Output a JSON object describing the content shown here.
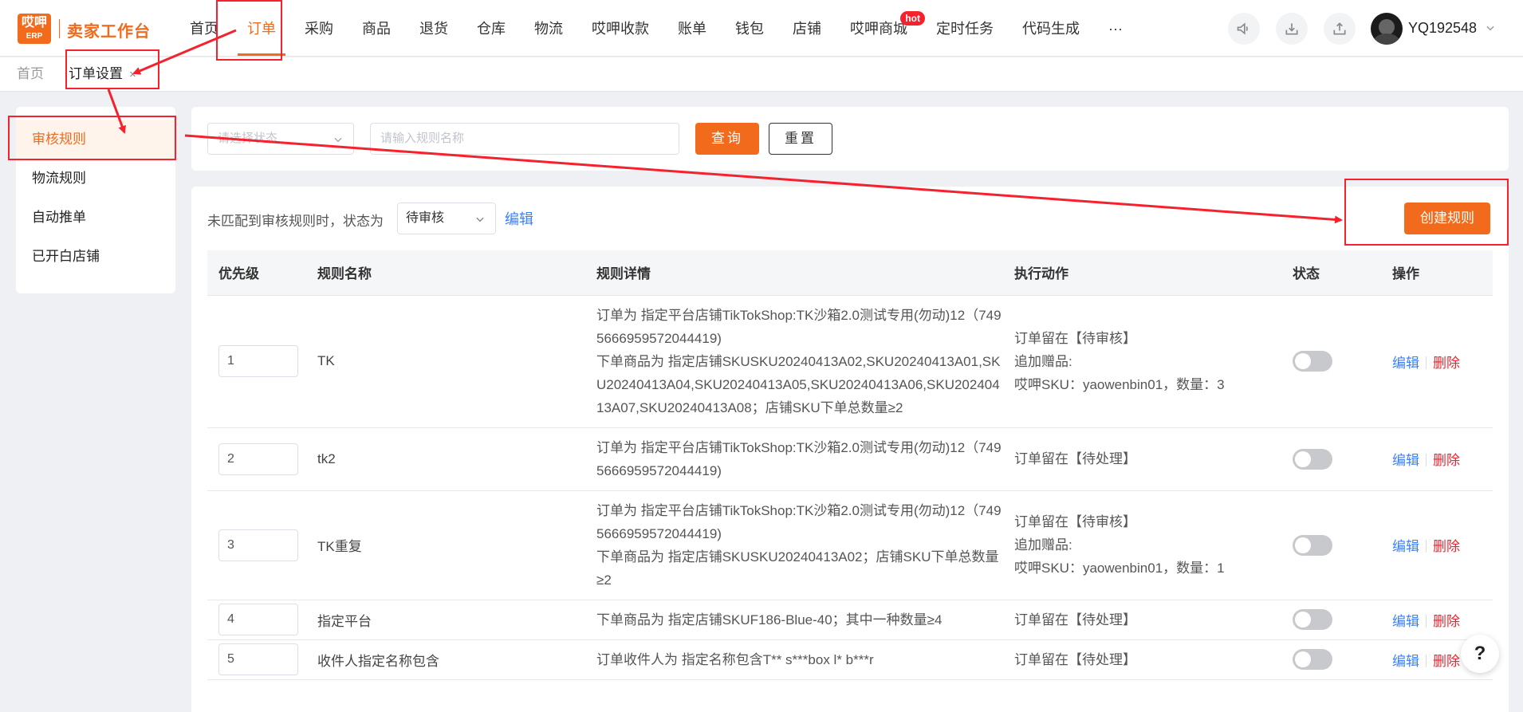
{
  "app": {
    "logo_top": "哎呷",
    "logo_bottom": "ERP",
    "title": "卖家工作台"
  },
  "nav": {
    "items": [
      "首页",
      "订单",
      "采购",
      "商品",
      "退货",
      "仓库",
      "物流",
      "哎呷收款",
      "账单",
      "钱包",
      "店铺",
      "哎呷商城",
      "定时任务",
      "代码生成",
      "···"
    ],
    "active_index": 1,
    "hot_badge": "hot"
  },
  "header_icons": [
    "megaphone-icon",
    "download-icon",
    "upload-icon"
  ],
  "user": {
    "name": "YQ192548"
  },
  "breadcrumb_tabs": {
    "home": "首页",
    "current": "订单设置",
    "close": "×"
  },
  "sidebar": {
    "items": [
      "审核规则",
      "物流规则",
      "自动推单",
      "已开白店铺"
    ],
    "active_index": 0
  },
  "filter": {
    "status_placeholder": "请选择状态",
    "name_placeholder": "请输入规则名称",
    "query_label": "查询",
    "reset_label": "重置"
  },
  "panel": {
    "unmatched_label": "未匹配到审核规则时，状态为",
    "unmatched_status": "待审核",
    "edit_label": "编辑",
    "create_label": "创建规则"
  },
  "table": {
    "columns": [
      "优先级",
      "规则名称",
      "规则详情",
      "执行动作",
      "状态",
      "操作"
    ],
    "rows": [
      {
        "priority": "1",
        "name": "TK",
        "detail": [
          "订单为 指定平台店铺TikTokShop:TK沙箱2.0测试专用(勿动)12（7495666959572044419)",
          "下单商品为 指定店铺SKUSKU20240413A02,SKU20240413A01,SKU20240413A04,SKU20240413A05,SKU20240413A06,SKU20240413A07,SKU20240413A08；店铺SKU下单总数量≥2"
        ],
        "action": [
          "订单留在【待审核】",
          "追加赠品:",
          "哎呷SKU：yaowenbin01，数量：3"
        ],
        "enabled": false,
        "edit": "编辑",
        "delete": "删除"
      },
      {
        "priority": "2",
        "name": "tk2",
        "detail": [
          "订单为 指定平台店铺TikTokShop:TK沙箱2.0测试专用(勿动)12（7495666959572044419)"
        ],
        "action": [
          "订单留在【待处理】"
        ],
        "enabled": false,
        "edit": "编辑",
        "delete": "删除"
      },
      {
        "priority": "3",
        "name": "TK重复",
        "detail": [
          "订单为 指定平台店铺TikTokShop:TK沙箱2.0测试专用(勿动)12（7495666959572044419)",
          "下单商品为 指定店铺SKUSKU20240413A02；店铺SKU下单总数量≥2"
        ],
        "action": [
          "订单留在【待审核】",
          "追加赠品:",
          "哎呷SKU：yaowenbin01，数量：1"
        ],
        "enabled": false,
        "edit": "编辑",
        "delete": "删除"
      },
      {
        "priority": "4",
        "name": "指定平台",
        "detail": [
          "下单商品为 指定店铺SKUF186-Blue-40；其中一种数量≥4"
        ],
        "action": [
          "订单留在【待处理】"
        ],
        "enabled": false,
        "edit": "编辑",
        "delete": "删除"
      },
      {
        "priority": "5",
        "name": "收件人指定名称包含",
        "detail": [
          "订单收件人为 指定名称包含T** s***box l* b***r"
        ],
        "action": [
          "订单留在【待处理】"
        ],
        "enabled": false,
        "edit": "编辑",
        "delete": "删除"
      }
    ]
  },
  "help": {
    "label": "?"
  },
  "colors": {
    "brand": "#f26b1d",
    "link": "#3d7fff",
    "danger": "#f5222d",
    "annotation": "#f5222d"
  }
}
